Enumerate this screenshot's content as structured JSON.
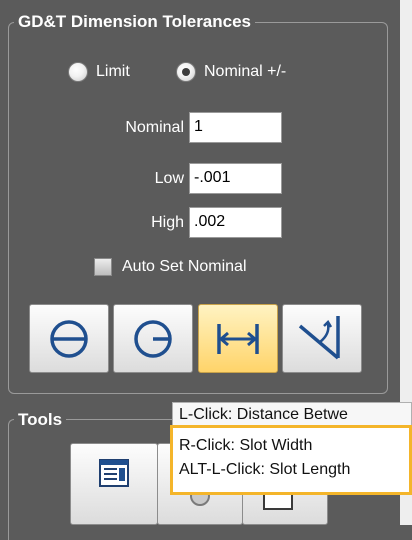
{
  "panel": {
    "title": "GD&T Dimension Tolerances",
    "mode": {
      "options": [
        {
          "label": "Limit",
          "checked": false
        },
        {
          "label": "Nominal +/-",
          "checked": true
        }
      ]
    },
    "fields": {
      "nominal": {
        "label": "Nominal",
        "value": "1"
      },
      "low": {
        "label": "Low",
        "value": "-.001"
      },
      "high": {
        "label": "High",
        "value": ".002"
      }
    },
    "auto_set_nominal": {
      "label": "Auto Set Nominal",
      "checked": false
    },
    "dimension_tools": [
      {
        "icon": "circle-diameter-icon",
        "active": false
      },
      {
        "icon": "circle-radius-icon",
        "active": false
      },
      {
        "icon": "linear-distance-icon",
        "active": true
      },
      {
        "icon": "angle-icon",
        "active": false
      }
    ]
  },
  "tools": {
    "title": "Tools",
    "buttons": [
      {
        "icon": "report-list-icon"
      },
      {
        "icon": "tool-icon"
      },
      {
        "icon": "tool-icon"
      }
    ]
  },
  "tooltip": {
    "line1": "L-Click: Distance Betwe",
    "line2": "R-Click: Slot Width",
    "line3": "ALT-L-Click: Slot Length"
  },
  "colors": {
    "panel_bg": "#5b5b5b",
    "active_button": "#ffd46a",
    "tooltip_border": "#f4b52a",
    "icon_blue": "#1f4f8f"
  }
}
